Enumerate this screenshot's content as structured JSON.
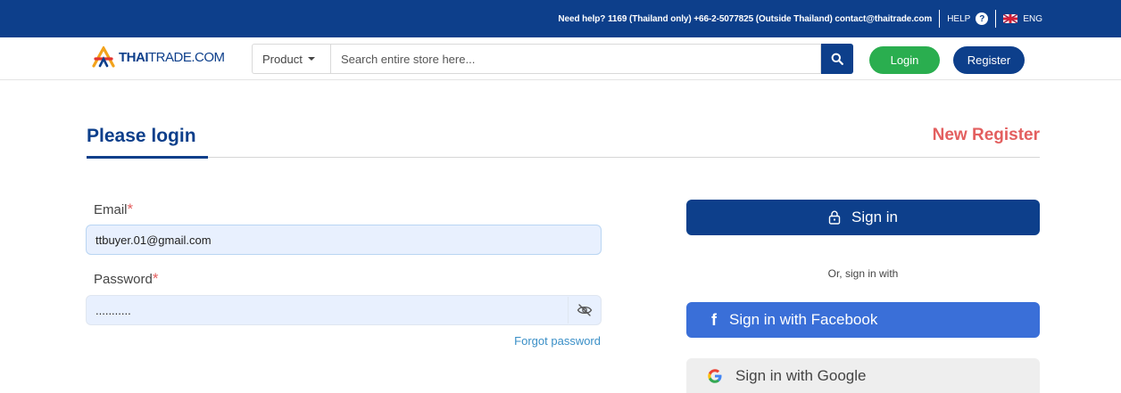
{
  "topbar": {
    "help_text": "Need help? 1169 (Thailand only) +66-2-5077825 (Outside Thailand) contact@thaitrade.com",
    "help_label": "HELP",
    "help_icon": "question-circle-icon",
    "language": "ENG"
  },
  "header": {
    "logo_bold": "THAI",
    "logo_rest": "TRADE.COM",
    "product_label": "Product",
    "search_placeholder": "Search entire store here...",
    "login_label": "Login",
    "register_label": "Register"
  },
  "main": {
    "title": "Please login",
    "new_register": "New Register",
    "email_label": "Email",
    "password_label": "Password",
    "required_mark": "*",
    "email_value": "ttbuyer.01@gmail.com",
    "password_value": "...........",
    "forgot_password": "Forgot password",
    "signin_label": "Sign in",
    "or_text": "Or, sign in with",
    "facebook_label": "Sign in with Facebook",
    "google_label": "Sign in with Google"
  },
  "colors": {
    "brand": "#0d3f8b",
    "login_green": "#2aae4f",
    "accent_red": "#e35f5f",
    "facebook": "#3a6fd8"
  }
}
